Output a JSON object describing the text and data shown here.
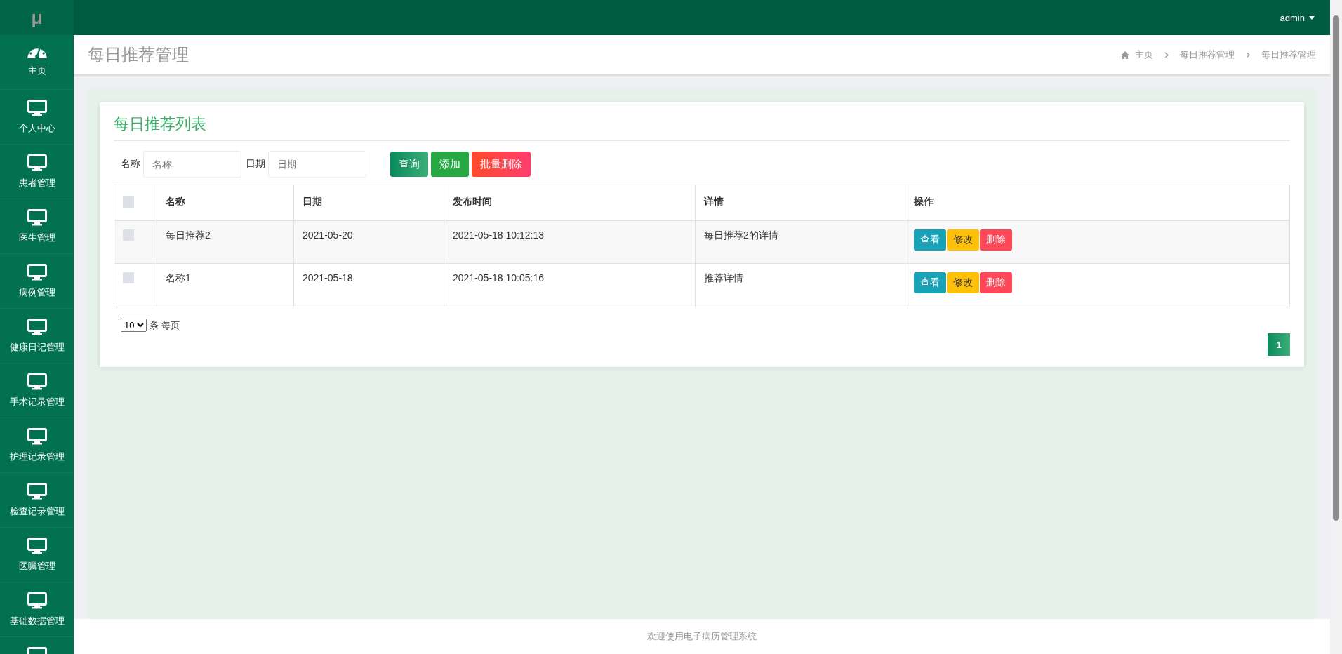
{
  "sidebar": {
    "logo": "μ",
    "items": [
      {
        "label": "主页"
      },
      {
        "label": "个人中心"
      },
      {
        "label": "患者管理"
      },
      {
        "label": "医生管理"
      },
      {
        "label": "病例管理"
      },
      {
        "label": "健康日记管理"
      },
      {
        "label": "手术记录管理"
      },
      {
        "label": "护理记录管理"
      },
      {
        "label": "检查记录管理"
      },
      {
        "label": "医嘱管理"
      },
      {
        "label": "基础数据管理"
      },
      {
        "cut_off": true
      }
    ]
  },
  "topbar": {
    "user": "admin"
  },
  "page_header": {
    "title": "每日推荐管理",
    "breadcrumb": [
      "主页",
      "每日推荐管理",
      "每日推荐管理"
    ]
  },
  "card": {
    "title": "每日推荐列表",
    "filters": [
      {
        "label": "名称",
        "placeholder": "名称"
      },
      {
        "label": "日期",
        "placeholder": "日期"
      }
    ],
    "buttons": [
      {
        "label": "查询",
        "kind": "search"
      },
      {
        "label": "添加",
        "kind": "add"
      },
      {
        "label": "批量删除",
        "kind": "delete"
      }
    ],
    "table": {
      "select_all": {
        "checked": false
      },
      "columns": [
        "名称",
        "日期",
        "发布时间",
        "详情",
        "操作"
      ],
      "rows": [
        {
          "checked": false,
          "cells": [
            "每日推荐2",
            "2021-05-20",
            "2021-05-18 10:12:13",
            "每日推荐2的详情"
          ],
          "actions": [
            {
              "label": "查看",
              "kind": "view"
            },
            {
              "label": "修改",
              "kind": "edit"
            },
            {
              "label": "删除",
              "kind": "delete"
            }
          ]
        },
        {
          "checked": false,
          "cells": [
            "名称1",
            "2021-05-18",
            "2021-05-18 10:05:16",
            "推荐详情"
          ],
          "actions": [
            {
              "label": "查看",
              "kind": "view"
            },
            {
              "label": "修改",
              "kind": "edit"
            },
            {
              "label": "删除",
              "kind": "delete"
            }
          ]
        }
      ]
    },
    "page_size": {
      "value": "10",
      "suffix": "条 每页"
    },
    "pagination": [
      {
        "label": "1",
        "selected": true
      }
    ]
  },
  "footer": {
    "text": "欢迎使用电子病历管理系统"
  }
}
